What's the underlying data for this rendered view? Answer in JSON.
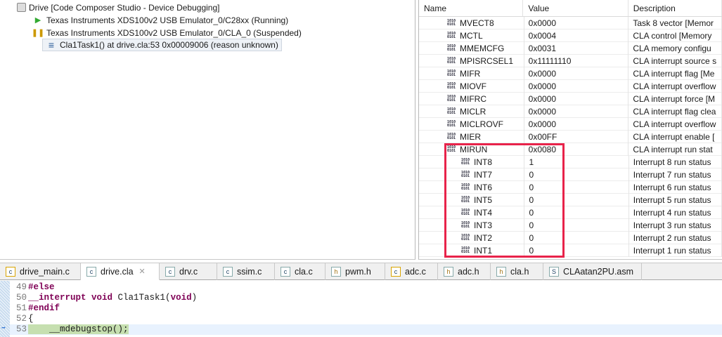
{
  "debug_tree": {
    "session": "Drive [Code Composer Studio - Device Debugging]",
    "cores": [
      {
        "label": "Texas Instruments XDS100v2 USB Emulator_0/C28xx (Running)"
      },
      {
        "label": "Texas Instruments XDS100v2 USB Emulator_0/CLA_0 (Suspended)"
      }
    ],
    "frame": "Cla1Task1() at drive.cla:53 0x00009006  (reason unknown)"
  },
  "registers": {
    "headers": [
      "Name",
      "Value",
      "Description"
    ],
    "rows": [
      {
        "name": "MVECT8",
        "value": "0x0000",
        "desc": "Task 8 vector [Memor"
      },
      {
        "name": "MCTL",
        "value": "0x0004",
        "desc": "CLA control [Memory"
      },
      {
        "name": "MMEMCFG",
        "value": "0x0031",
        "desc": "CLA memory configu"
      },
      {
        "name": "MPISRCSEL1",
        "value": "0x11111110",
        "desc": "CLA interrupt source s"
      },
      {
        "name": "MIFR",
        "value": "0x0000",
        "desc": "CLA interrupt flag [Me"
      },
      {
        "name": "MIOVF",
        "value": "0x0000",
        "desc": "CLA interrupt overflow"
      },
      {
        "name": "MIFRC",
        "value": "0x0000",
        "desc": "CLA interrupt force [M"
      },
      {
        "name": "MICLR",
        "value": "0x0000",
        "desc": "CLA interrupt flag clea"
      },
      {
        "name": "MICLROVF",
        "value": "0x0000",
        "desc": "CLA interrupt overflow"
      },
      {
        "name": "MIER",
        "value": "0x00FF",
        "desc": "CLA interrupt enable ["
      },
      {
        "name": "MIRUN",
        "value": "0x0080",
        "desc": "CLA interrupt run stat"
      },
      {
        "name": "INT8",
        "value": "1",
        "desc": "Interrupt 8 run status",
        "child": true
      },
      {
        "name": "INT7",
        "value": "0",
        "desc": "Interrupt 7 run status",
        "child": true
      },
      {
        "name": "INT6",
        "value": "0",
        "desc": "Interrupt 6 run status",
        "child": true
      },
      {
        "name": "INT5",
        "value": "0",
        "desc": "Interrupt 5 run status",
        "child": true
      },
      {
        "name": "INT4",
        "value": "0",
        "desc": "Interrupt 4 run status",
        "child": true
      },
      {
        "name": "INT3",
        "value": "0",
        "desc": "Interrupt 3 run status",
        "child": true
      },
      {
        "name": "INT2",
        "value": "0",
        "desc": "Interrupt 2 run status",
        "child": true
      },
      {
        "name": "INT1",
        "value": "0",
        "desc": "Interrupt 1 run status",
        "child": true
      }
    ],
    "highlight_color": "#e8234a"
  },
  "editor": {
    "tabs": [
      {
        "label": "drive_main.c",
        "icon": "c",
        "warn": true
      },
      {
        "label": "drive.cla",
        "icon": "c",
        "active": true
      },
      {
        "label": "drv.c",
        "icon": "c"
      },
      {
        "label": "ssim.c",
        "icon": "c"
      },
      {
        "label": "cla.c",
        "icon": "c"
      },
      {
        "label": "pwm.h",
        "icon": "h"
      },
      {
        "label": "adc.c",
        "icon": "c",
        "warn": true
      },
      {
        "label": "adc.h",
        "icon": "h"
      },
      {
        "label": "cla.h",
        "icon": "h"
      },
      {
        "label": "CLAatan2PU.asm",
        "icon": "S"
      }
    ],
    "close_glyph": "✕",
    "lines": [
      {
        "num": "49",
        "code": "#else"
      },
      {
        "num": "50",
        "code": "__interrupt void Cla1Task1(void)"
      },
      {
        "num": "51",
        "code": "#endif"
      },
      {
        "num": "52",
        "code": "{"
      },
      {
        "num": "53",
        "code": "    __mdebugstop();"
      }
    ]
  }
}
